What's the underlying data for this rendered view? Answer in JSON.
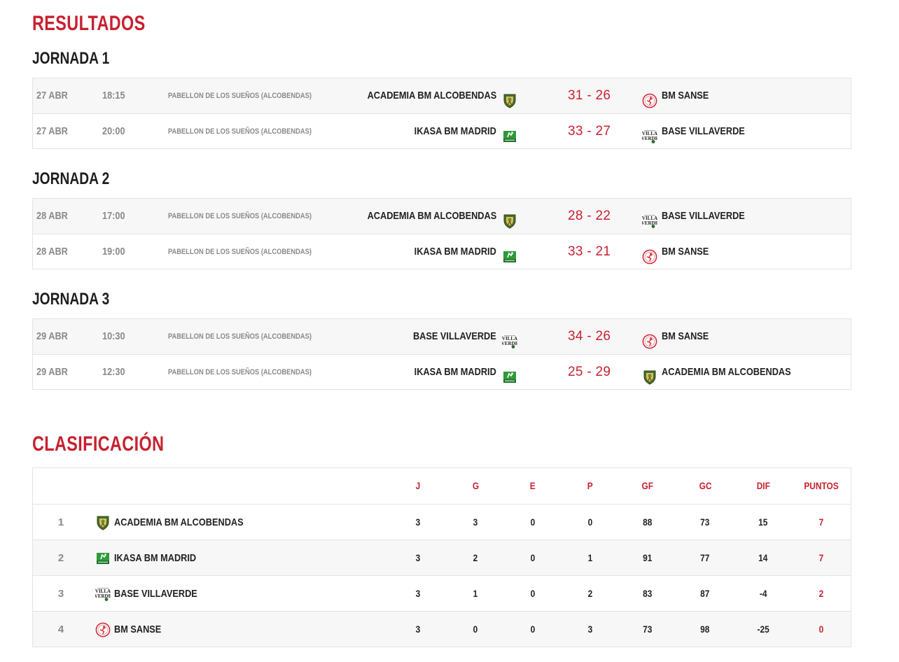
{
  "results": {
    "title": "RESULTADOS",
    "rounds": [
      {
        "name": "JORNADA 1",
        "matches": [
          {
            "date": "27 ABR",
            "time": "18:15",
            "venue": "PABELLON DE LOS SUEÑOS (ALCOBENDAS)",
            "home": "ACADEMIA BM ALCOBENDAS",
            "home_logo": "alcobendas-shield-icon",
            "score": "31 - 26",
            "away": "BM SANSE",
            "away_logo": "sanse-crest-icon"
          },
          {
            "date": "27 ABR",
            "time": "20:00",
            "venue": "PABELLON DE LOS SUEÑOS (ALCOBENDAS)",
            "home": "IKASA BM MADRID",
            "home_logo": "ikasa-badge-icon",
            "score": "33 - 27",
            "away": "BASE VILLAVERDE",
            "away_logo": "villaverde-logo-icon"
          }
        ]
      },
      {
        "name": "JORNADA 2",
        "matches": [
          {
            "date": "28 ABR",
            "time": "17:00",
            "venue": "PABELLON DE LOS SUEÑOS (ALCOBENDAS)",
            "home": "ACADEMIA BM ALCOBENDAS",
            "home_logo": "alcobendas-shield-icon",
            "score": "28 - 22",
            "away": "BASE VILLAVERDE",
            "away_logo": "villaverde-logo-icon"
          },
          {
            "date": "28 ABR",
            "time": "19:00",
            "venue": "PABELLON DE LOS SUEÑOS (ALCOBENDAS)",
            "home": "IKASA BM MADRID",
            "home_logo": "ikasa-badge-icon",
            "score": "33 - 21",
            "away": "BM SANSE",
            "away_logo": "sanse-crest-icon"
          }
        ]
      },
      {
        "name": "JORNADA 3",
        "matches": [
          {
            "date": "29 ABR",
            "time": "10:30",
            "venue": "PABELLON DE LOS SUEÑOS (ALCOBENDAS)",
            "home": "BASE VILLAVERDE",
            "home_logo": "villaverde-logo-icon",
            "score": "34 - 26",
            "away": "BM SANSE",
            "away_logo": "sanse-crest-icon"
          },
          {
            "date": "29 ABR",
            "time": "12:30",
            "venue": "PABELLON DE LOS SUEÑOS (ALCOBENDAS)",
            "home": "IKASA BM MADRID",
            "home_logo": "ikasa-badge-icon",
            "score": "25 - 29",
            "away": "ACADEMIA BM ALCOBENDAS",
            "away_logo": "alcobendas-shield-icon"
          }
        ]
      }
    ]
  },
  "standings": {
    "title": "CLASIFICACIÓN",
    "columns": [
      "J",
      "G",
      "E",
      "P",
      "GF",
      "GC",
      "DIF",
      "PUNTOS"
    ],
    "rows": [
      {
        "pos": "1",
        "team": "ACADEMIA BM ALCOBENDAS",
        "logo": "alcobendas-shield-icon",
        "J": "3",
        "G": "3",
        "E": "0",
        "P": "0",
        "GF": "88",
        "GC": "73",
        "DIF": "15",
        "PUNTOS": "7"
      },
      {
        "pos": "2",
        "team": "IKASA BM MADRID",
        "logo": "ikasa-badge-icon",
        "J": "3",
        "G": "2",
        "E": "0",
        "P": "1",
        "GF": "91",
        "GC": "77",
        "DIF": "14",
        "PUNTOS": "7"
      },
      {
        "pos": "3",
        "team": "BASE VILLAVERDE",
        "logo": "villaverde-logo-icon",
        "J": "3",
        "G": "1",
        "E": "0",
        "P": "2",
        "GF": "83",
        "GC": "87",
        "DIF": "-4",
        "PUNTOS": "2"
      },
      {
        "pos": "4",
        "team": "BM SANSE",
        "logo": "sanse-crest-icon",
        "J": "3",
        "G": "0",
        "E": "0",
        "P": "3",
        "GF": "73",
        "GC": "98",
        "DIF": "-25",
        "PUNTOS": "0"
      }
    ]
  },
  "colors": {
    "accent": "#c8202f",
    "muted": "#8a8a8a",
    "text": "#222222",
    "row_alt": "#f7f7f7",
    "border": "#e4e4e4"
  }
}
